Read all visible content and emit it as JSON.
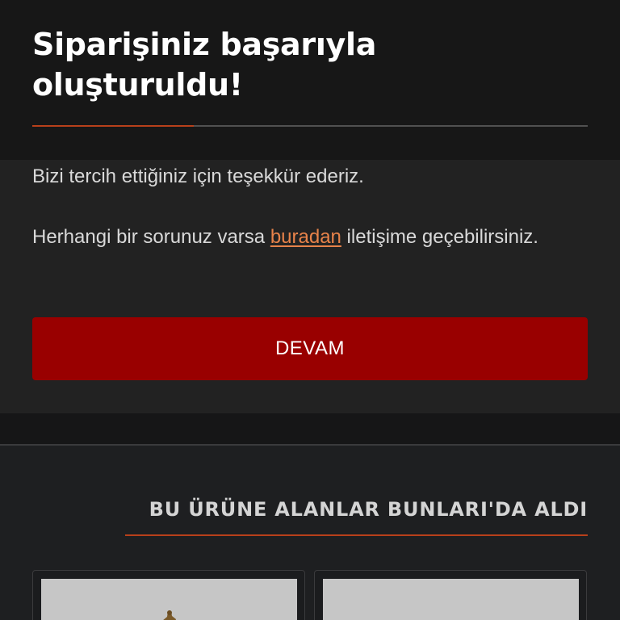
{
  "confirmation": {
    "title": "Siparişiniz başarıyla oluşturuldu!",
    "thanks_text": "Bizi tercih ettiğiniz için teşekkür ederiz.",
    "contact_prefix": "Herhangi bir sorunuz varsa ",
    "contact_link": "buradan",
    "contact_suffix": " iletişime geçebilirsiniz.",
    "continue_label": "DEVAM"
  },
  "recommendations": {
    "title": "BU ÜRÜNE ALANLAR BUNLARI'DA ALDI",
    "products": [
      {
        "image_icon": "figurine-image"
      },
      {
        "image_icon": "product-image"
      }
    ]
  },
  "colors": {
    "accent": "#b8401a",
    "button": "#990000",
    "link": "#e8834a",
    "background": "#1e1f21"
  }
}
